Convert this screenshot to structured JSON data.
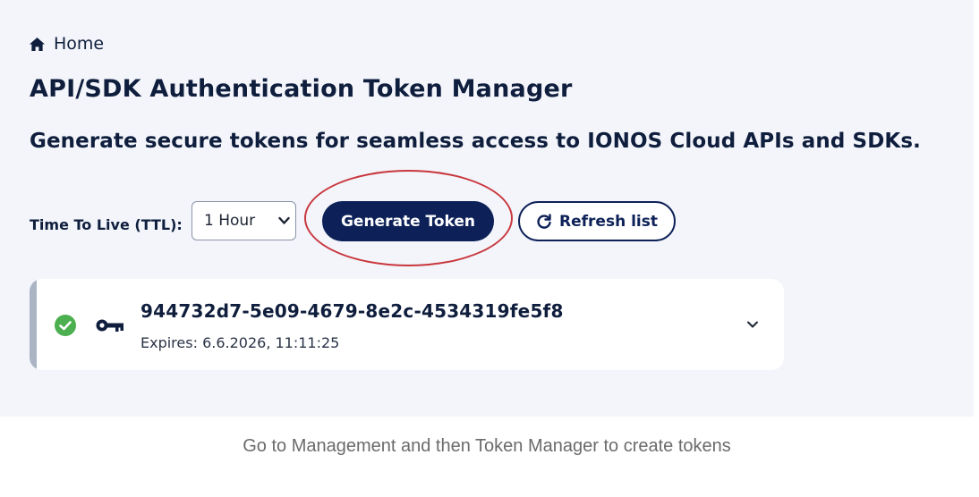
{
  "breadcrumb": {
    "home_label": "Home"
  },
  "header": {
    "title": "API/SDK Authentication Token Manager",
    "subtitle": "Generate secure tokens for seamless access to IONOS Cloud APIs and SDKs."
  },
  "controls": {
    "ttl_label": "Time To Live (TTL):",
    "ttl_value": "1 Hour",
    "generate_label": "Generate Token",
    "refresh_label": "Refresh list"
  },
  "tokens": [
    {
      "id": "944732d7-5e09-4679-8e2c-4534319fe5f8",
      "expires": "Expires: 6.6.2026, 11:11:25",
      "status": "valid"
    }
  ],
  "caption": "Go to Management and then Token Manager to create tokens",
  "colors": {
    "accent_navy": "#0d2158",
    "highlight_red": "#c8373d",
    "success_green": "#4caf50"
  },
  "icons": [
    "home-icon",
    "chevron-down-icon",
    "refresh-icon",
    "check-circle-icon",
    "key-icon",
    "expand-chevron-icon"
  ]
}
